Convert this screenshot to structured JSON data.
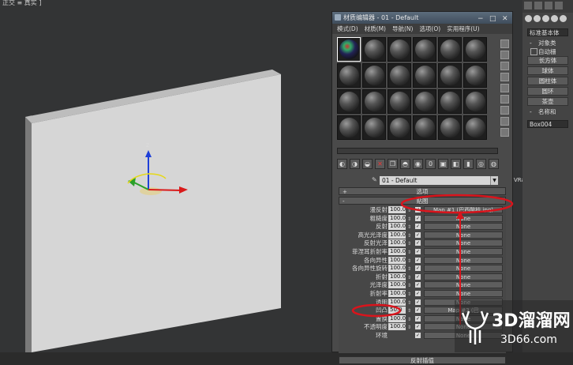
{
  "viewport": {
    "label": "正交 ≡ 真实 ]"
  },
  "material_editor": {
    "title": "材质编辑器 - 01 - Default",
    "menu": [
      "模式(D)",
      "材质(M)",
      "导航(N)",
      "选项(O)",
      "实用程序(U)"
    ],
    "material_name": "01 - Default",
    "material_type": "VRayMtl",
    "rollout_options": "选项",
    "rollout_maps": "贴图",
    "rollout_reflect": "反射插值",
    "maps": [
      {
        "label": "漫反射",
        "value": "100.0",
        "map": "Map #1 (巴西酸枝.jpg)"
      },
      {
        "label": "粗糙度",
        "value": "100.0",
        "map": "None"
      },
      {
        "label": "反射",
        "value": "100.0",
        "map": "None"
      },
      {
        "label": "高光光泽度",
        "value": "100.0",
        "map": "None"
      },
      {
        "label": "反射光泽",
        "value": "100.0",
        "map": "None"
      },
      {
        "label": "菲涅耳折射率",
        "value": "100.0",
        "map": "None"
      },
      {
        "label": "各向异性",
        "value": "100.0",
        "map": "None"
      },
      {
        "label": "各向异性旋转",
        "value": "100.0",
        "map": "None"
      },
      {
        "label": "折射",
        "value": "100.0",
        "map": "None"
      },
      {
        "label": "光泽度",
        "value": "100.0",
        "map": "None"
      },
      {
        "label": "折射率",
        "value": "100.0",
        "map": "None"
      },
      {
        "label": "透明",
        "value": "100.0",
        "map": "None"
      },
      {
        "label": "凹凸",
        "value": "50.0",
        "map": "Map #3 (巴"
      },
      {
        "label": "置换",
        "value": "100.0",
        "map": "None"
      },
      {
        "label": "不透明度",
        "value": "100.0",
        "map": "None"
      },
      {
        "label": "环境",
        "value": "",
        "map": "None"
      }
    ]
  },
  "command_panel": {
    "dropdown": "标准基本体",
    "section_object_type": "对象类",
    "autogrid": "自动栅",
    "buttons": [
      "长方体",
      "球体",
      "圆柱体",
      "圆环",
      "茶壶"
    ],
    "section_name": "名称和",
    "object_name": "Box004"
  },
  "watermark": {
    "line1": "3D溜溜网",
    "line2": "3D66.com"
  },
  "colors": {
    "highlight_red": "#d9141c",
    "viewport_bg": "#333435",
    "wall_face": "#d8d8d8"
  }
}
